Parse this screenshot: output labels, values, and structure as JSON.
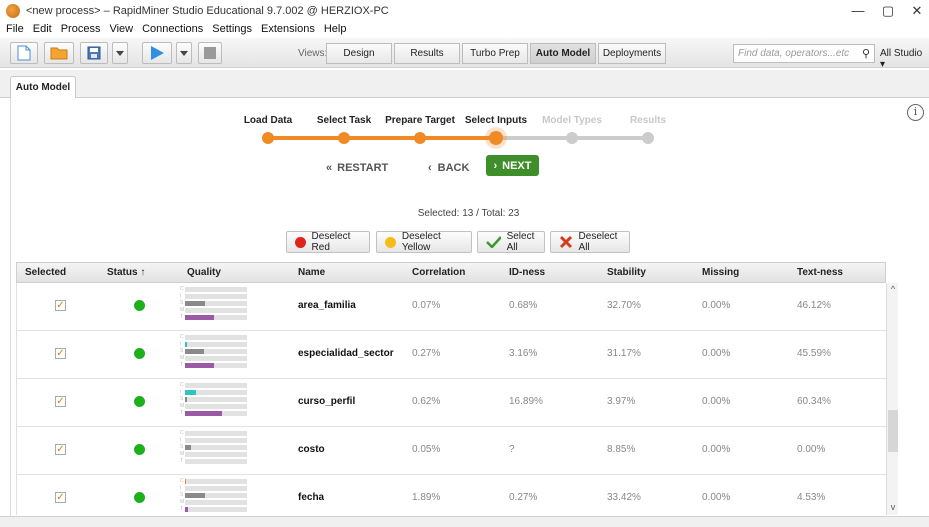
{
  "window": {
    "title": "<new process> – RapidMiner Studio Educational 9.7.002 @ HERZIOX-PC",
    "controls": [
      "—",
      "▢",
      "✕"
    ]
  },
  "menu": [
    "File",
    "Edit",
    "Process",
    "View",
    "Connections",
    "Settings",
    "Extensions",
    "Help"
  ],
  "toolbar": {
    "views_label": "Views:",
    "views": [
      "Design",
      "Results",
      "Turbo Prep",
      "Auto Model",
      "Deployments"
    ],
    "active_view": "Auto Model",
    "search_placeholder": "Find data, operators...etc",
    "scope": "All Studio ▾"
  },
  "panel_tab": "Auto Model",
  "steps": [
    "Load Data",
    "Select Task",
    "Prepare Target",
    "Select Inputs",
    "Model Types",
    "Results"
  ],
  "current_step": "Select Inputs",
  "nav": {
    "restart": "RESTART",
    "back": "BACK",
    "next": "NEXT"
  },
  "selection": {
    "text": "Selected: 13  /  Total: 23"
  },
  "actions": {
    "deselect_red": "Deselect Red",
    "deselect_yellow": "Deselect Yellow",
    "select_all": "Select All",
    "deselect_all": "Deselect All"
  },
  "table": {
    "columns": [
      "Selected",
      "Status ↑",
      "Quality",
      "Name",
      "Correlation",
      "ID-ness",
      "Stability",
      "Missing",
      "Text-ness"
    ],
    "rows": [
      {
        "name": "area_familia",
        "correlation": "0.07%",
        "idness": "0.68%",
        "stability": "32.70%",
        "missing": "0.00%",
        "textness": "46.12%",
        "quality": [
          0,
          0,
          0.32,
          0,
          0.46
        ]
      },
      {
        "name": "especialidad_sector",
        "correlation": "0.27%",
        "idness": "3.16%",
        "stability": "31.17%",
        "missing": "0.00%",
        "textness": "45.59%",
        "quality": [
          0,
          0.03,
          0.31,
          0,
          0.46
        ]
      },
      {
        "name": "curso_perfil",
        "correlation": "0.62%",
        "idness": "16.89%",
        "stability": "3.97%",
        "missing": "0.00%",
        "textness": "60.34%",
        "quality": [
          0,
          0.17,
          0.04,
          0,
          0.6
        ]
      },
      {
        "name": "costo",
        "correlation": "0.05%",
        "idness": "?",
        "stability": "8.85%",
        "missing": "0.00%",
        "textness": "0.00%",
        "quality": [
          0,
          0,
          0.09,
          0,
          0
        ]
      },
      {
        "name": "fecha",
        "correlation": "1.89%",
        "idness": "0.27%",
        "stability": "33.42%",
        "missing": "0.00%",
        "textness": "4.53%",
        "quality": [
          0.02,
          0,
          0.33,
          0,
          0.05
        ]
      }
    ]
  },
  "quality_letters": [
    "C",
    "I",
    "S",
    "M",
    "T"
  ],
  "colors": {
    "accent_orange": "#f08a24",
    "next_green": "#3e8e2a",
    "status_green": "#1db01d",
    "id_cyan": "#2ec4c4",
    "text_purple": "#9b5aa6",
    "stability_gray": "#8a8a8a"
  }
}
